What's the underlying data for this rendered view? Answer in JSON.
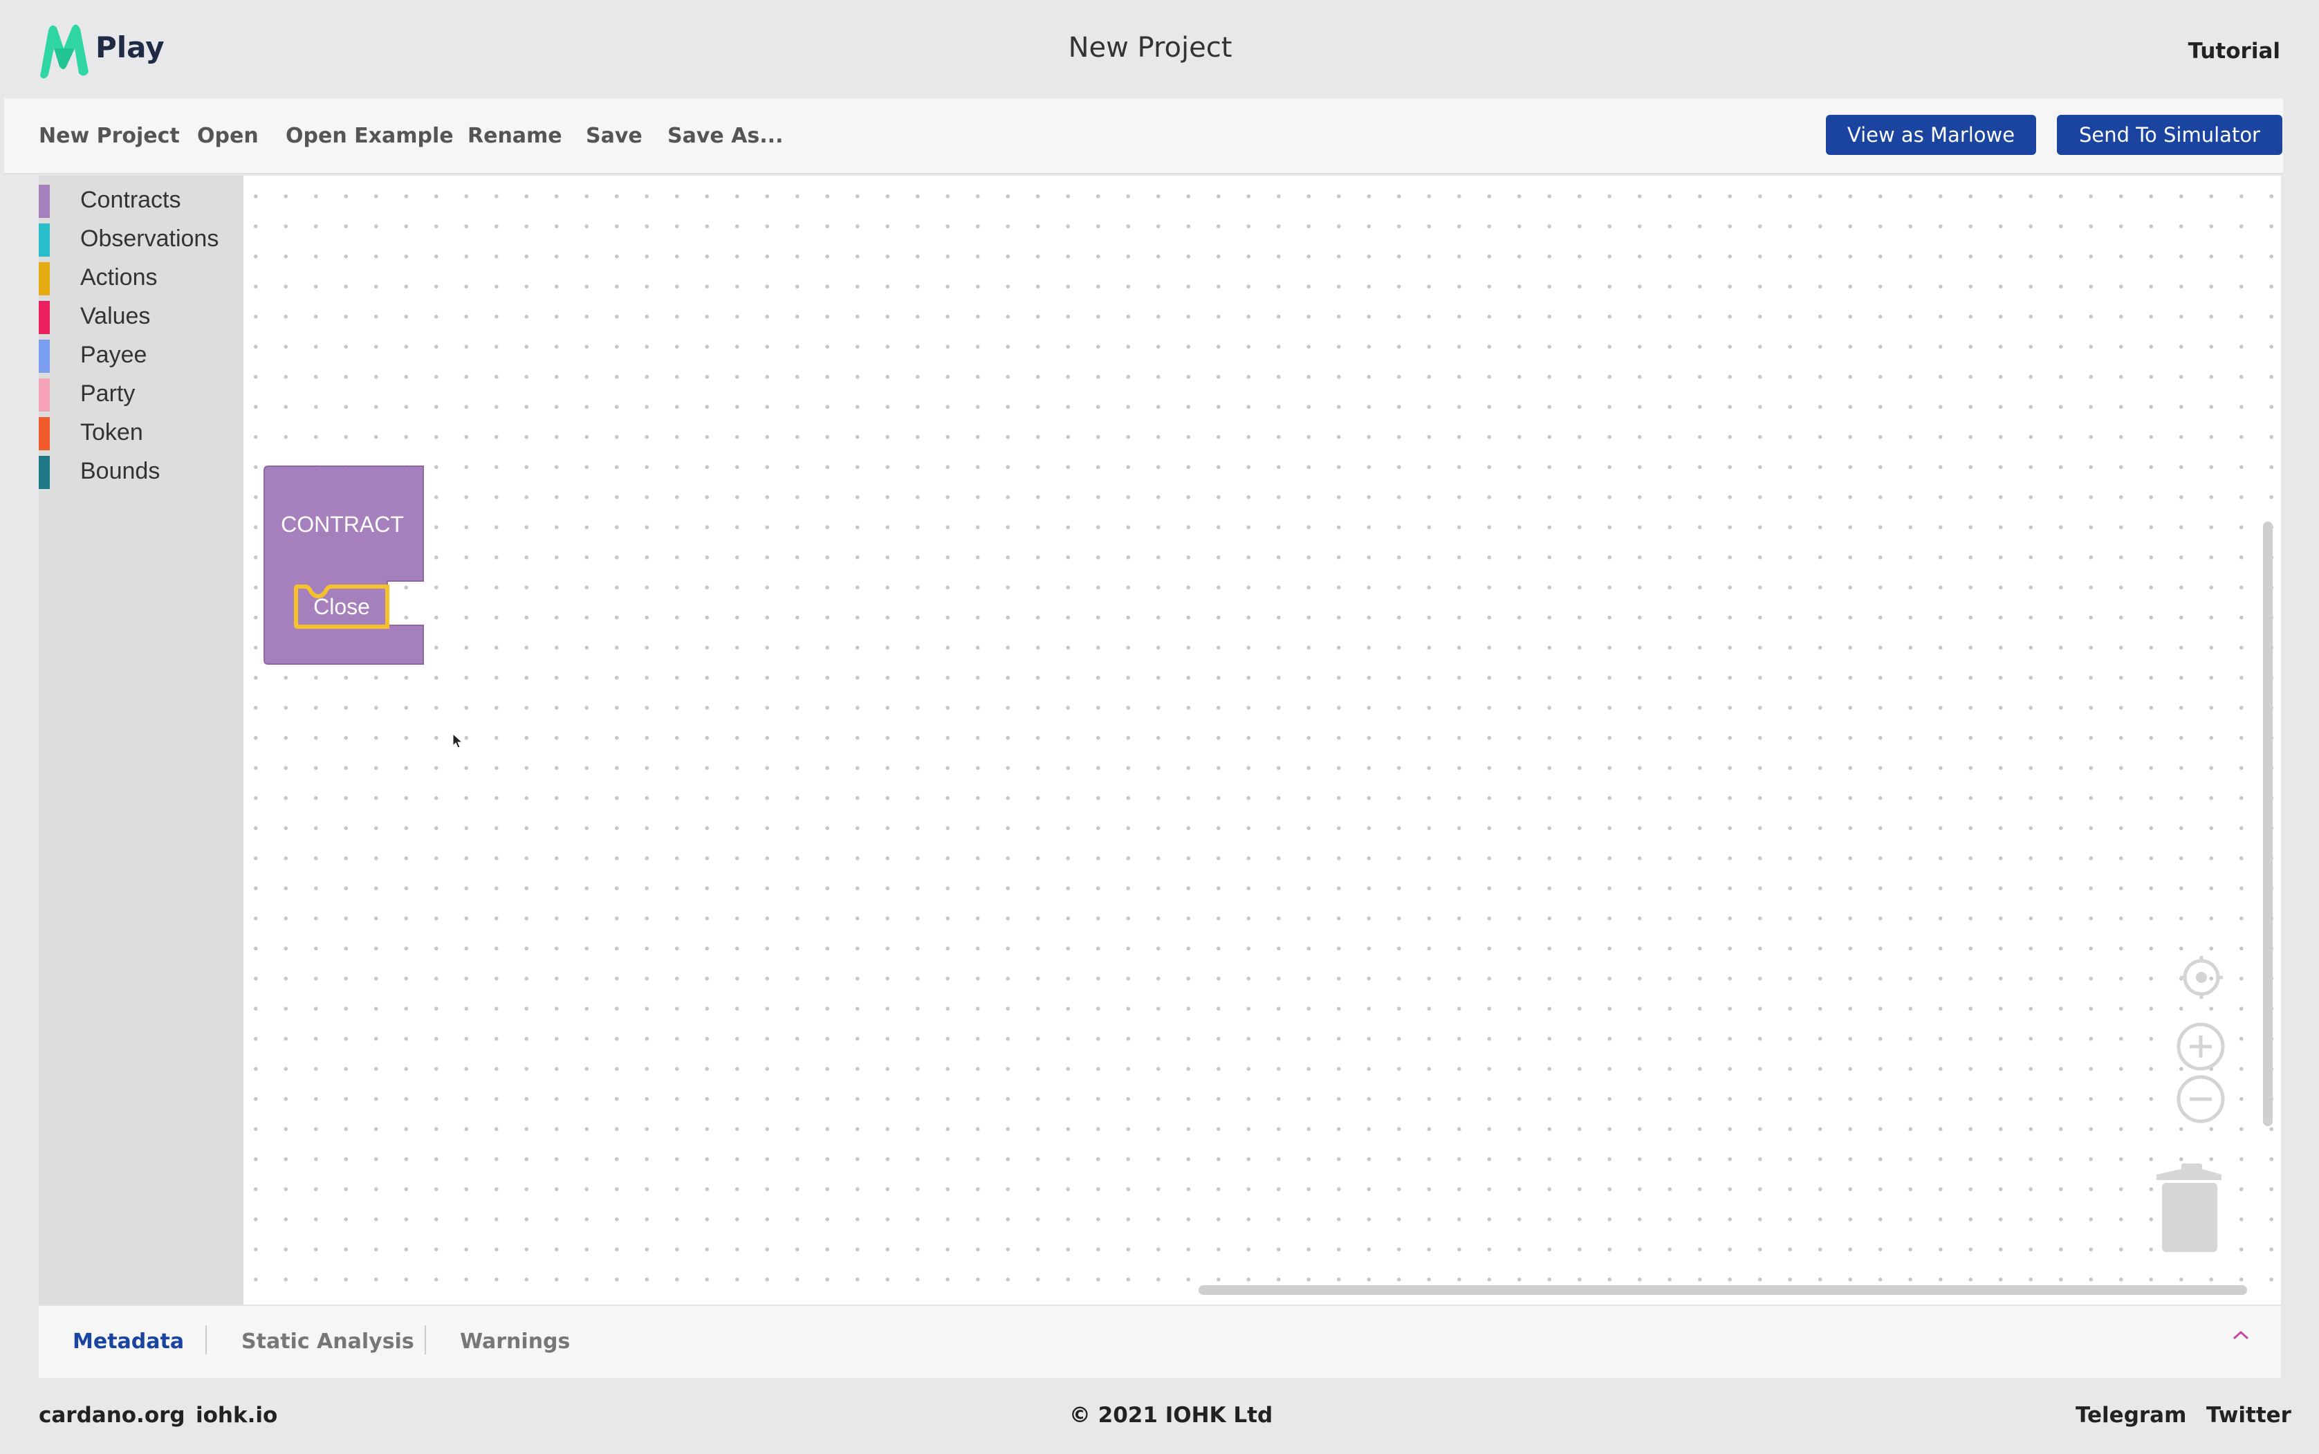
{
  "app": {
    "name": "Play",
    "title": "New Project",
    "tutorial": "Tutorial"
  },
  "toolbar": {
    "items": [
      "New Project",
      "Open",
      "Open Example",
      "Rename",
      "Save",
      "Save As..."
    ],
    "view_as_marlowe": "View as Marlowe",
    "send_to_simulator": "Send To Simulator"
  },
  "toolbox": {
    "categories": [
      {
        "label": "Contracts",
        "color": "#a67fbd"
      },
      {
        "label": "Observations",
        "color": "#26bfc9"
      },
      {
        "label": "Actions",
        "color": "#e4ab12"
      },
      {
        "label": "Values",
        "color": "#ea1f5c"
      },
      {
        "label": "Payee",
        "color": "#7c9ef2"
      },
      {
        "label": "Party",
        "color": "#f4a3b7"
      },
      {
        "label": "Token",
        "color": "#f15a2b"
      },
      {
        "label": "Bounds",
        "color": "#1e7a87"
      }
    ]
  },
  "workspace": {
    "contract_block": {
      "title": "CONTRACT",
      "child": "Close",
      "color": "#a67fbd",
      "highlight": "#f6c22b"
    },
    "controls": [
      "recenter-icon",
      "zoom-in-icon",
      "zoom-out-icon",
      "trash-icon"
    ]
  },
  "bottom_tabs": {
    "tabs": [
      "Metadata",
      "Static Analysis",
      "Warnings"
    ],
    "active": "Metadata",
    "collapse": "^"
  },
  "footer": {
    "links_left": [
      "cardano.org",
      "iohk.io"
    ],
    "copyright": "© 2021 IOHK Ltd",
    "links_right": [
      "Telegram",
      "Twitter"
    ]
  }
}
